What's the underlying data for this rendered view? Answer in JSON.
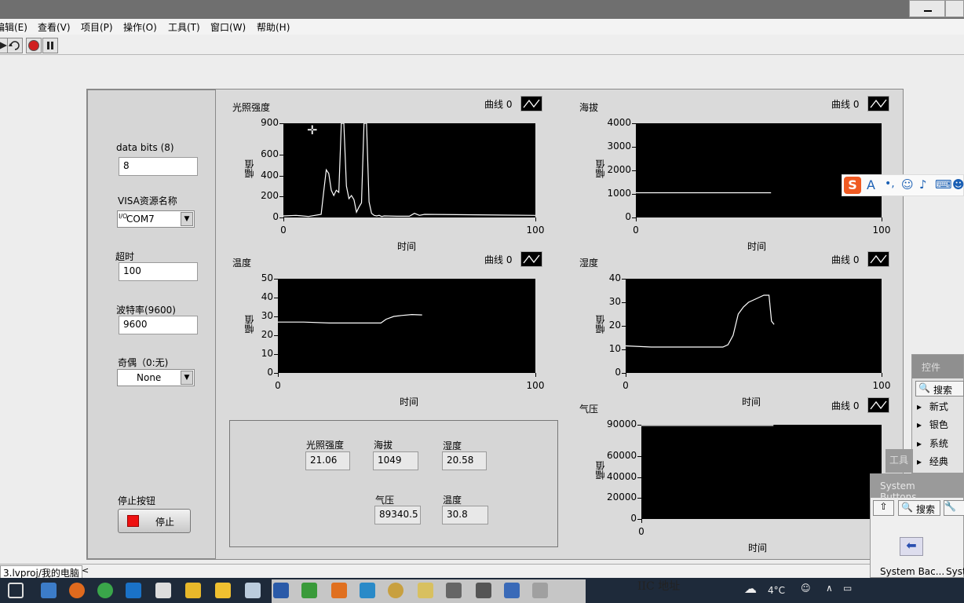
{
  "menu": [
    "编辑(E)",
    "查看(V)",
    "项目(P)",
    "操作(O)",
    "工具(T)",
    "窗口(W)",
    "帮助(H)"
  ],
  "controls": {
    "data_bits_label": "data bits (8)",
    "data_bits_value": "8",
    "visa_label": "VISA资源名称",
    "visa_prefix": "I/O",
    "visa_value": "COM7",
    "timeout_label": "超时",
    "timeout_value": "100",
    "baud_label": "波特率(9600)",
    "baud_value": "9600",
    "parity_label": "奇偶（0:无)",
    "parity_value": "None",
    "stop_label": "停止按钮",
    "stop_button": "停止"
  },
  "legend_label": "曲线 0",
  "chart_data": [
    {
      "type": "line",
      "title": "光照强度",
      "xlabel": "时间",
      "ylabel": "幅值",
      "xlim": [
        0,
        100
      ],
      "ylim": [
        0,
        900
      ],
      "yticks": [
        0,
        200,
        400,
        600,
        900
      ],
      "xticks": [
        0,
        100
      ],
      "x": [
        0,
        5,
        10,
        15,
        16,
        17,
        18,
        19,
        20,
        21,
        22,
        23,
        24,
        25,
        26,
        27,
        28,
        29,
        30,
        31,
        32,
        33,
        34,
        35,
        36,
        37,
        38,
        39,
        40,
        45,
        50,
        52,
        54,
        56,
        100
      ],
      "y": [
        15,
        20,
        10,
        30,
        250,
        455,
        420,
        260,
        210,
        260,
        240,
        900,
        900,
        300,
        180,
        210,
        170,
        50,
        100,
        140,
        900,
        900,
        150,
        40,
        20,
        15,
        20,
        10,
        15,
        12,
        12,
        40,
        20,
        30,
        20
      ]
    },
    {
      "type": "line",
      "title": "海拔",
      "xlabel": "时间",
      "ylabel": "幅值",
      "xlim": [
        0,
        100
      ],
      "ylim": [
        0,
        4000
      ],
      "yticks": [
        0,
        1000,
        2000,
        3000,
        4000
      ],
      "xticks": [
        0,
        100
      ],
      "x": [
        0,
        55
      ],
      "y": [
        1049,
        1049
      ]
    },
    {
      "type": "line",
      "title": "温度",
      "xlabel": "时间",
      "ylabel": "幅值",
      "xlim": [
        0,
        100
      ],
      "ylim": [
        0,
        50
      ],
      "yticks": [
        0,
        10,
        20,
        30,
        40,
        50
      ],
      "xticks": [
        0,
        100
      ],
      "x": [
        0,
        10,
        20,
        30,
        40,
        42,
        45,
        48,
        52,
        56
      ],
      "y": [
        27,
        27,
        26.5,
        26.5,
        26.5,
        28.5,
        30,
        30.5,
        31,
        30.8
      ]
    },
    {
      "type": "line",
      "title": "湿度",
      "xlabel": "时间",
      "ylabel": "幅值",
      "xlim": [
        0,
        100
      ],
      "ylim": [
        0,
        40
      ],
      "yticks": [
        0,
        10,
        20,
        30,
        40
      ],
      "xticks": [
        0,
        100
      ],
      "x": [
        0,
        10,
        20,
        30,
        38,
        40,
        42,
        44,
        46,
        48,
        50,
        52,
        54,
        56,
        57,
        58
      ],
      "y": [
        11.5,
        11,
        11,
        11,
        11,
        12,
        16,
        25,
        28,
        30,
        31,
        32,
        33,
        33,
        22,
        20.6
      ]
    },
    {
      "type": "line",
      "title": "气压",
      "xlabel": "时间",
      "ylabel": "幅值",
      "xlim": [
        0,
        100
      ],
      "ylim": [
        0,
        90000
      ],
      "yticks": [
        0,
        20000,
        40000,
        60000,
        90000
      ],
      "xticks": [
        0
      ],
      "x": [
        0,
        55
      ],
      "y": [
        89340,
        89340
      ]
    }
  ],
  "indicators": {
    "light_label": "光照强度",
    "light_value": "21.06",
    "alt_label": "海拔",
    "alt_value": "1049",
    "hum_label": "湿度",
    "hum_value": "20.58",
    "press_label": "气压",
    "press_value": "89340.5",
    "temp_label": "温度",
    "temp_value": "30.8"
  },
  "palette": {
    "title": "控件",
    "search": "搜索",
    "items": [
      "新式",
      "银色",
      "系统",
      "经典"
    ],
    "tools_title": "工具"
  },
  "sysbuttons": {
    "title": "System Buttons",
    "search": "搜索",
    "item1": "System Bac...",
    "item2": "Syst"
  },
  "status": {
    "path": "3.lvproj/我的电脑"
  },
  "taskbar": {
    "temp": "4°C",
    "doc_text": "IIC 地址"
  }
}
